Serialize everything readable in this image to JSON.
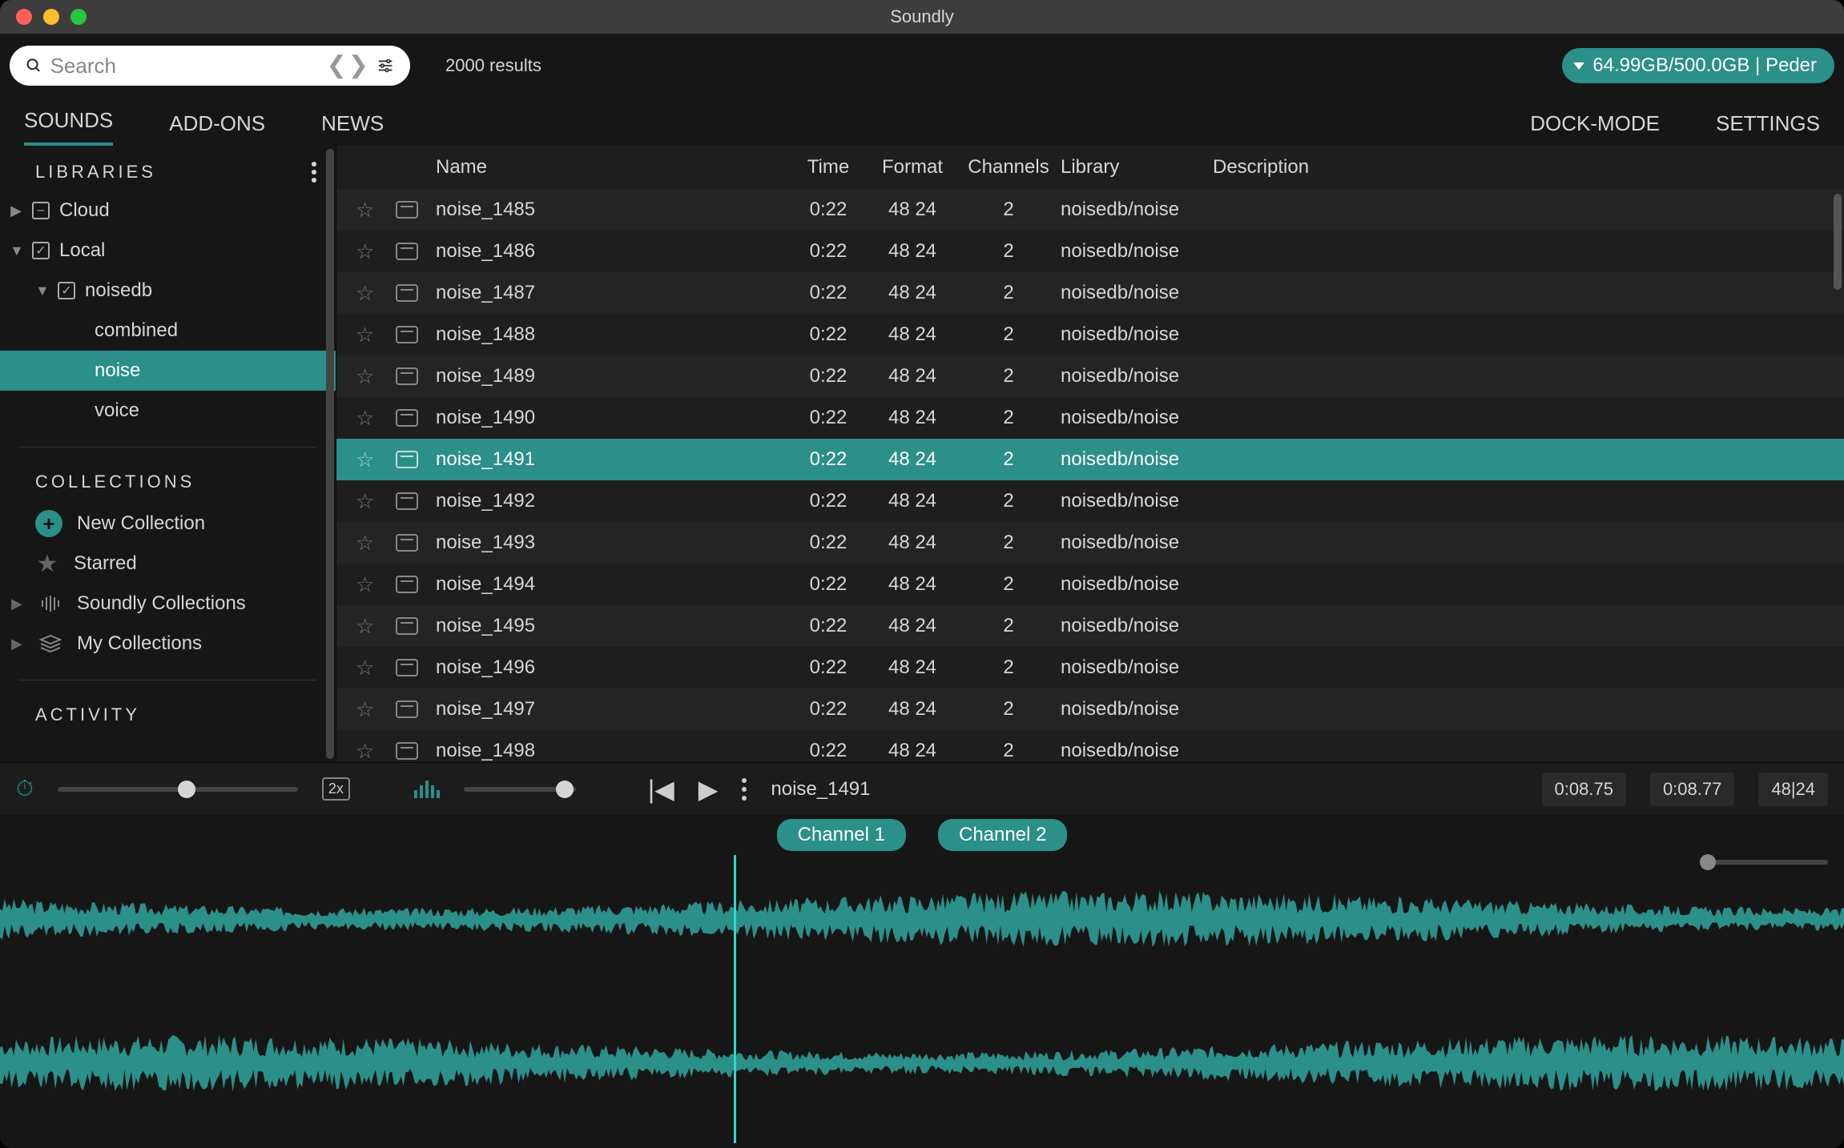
{
  "window": {
    "title": "Soundly"
  },
  "search": {
    "placeholder": "Search",
    "results": "2000 results"
  },
  "storage": {
    "label": "64.99GB/500.0GB | Peder"
  },
  "tabs": {
    "sounds": "SOUNDS",
    "addons": "ADD-ONS",
    "news": "NEWS",
    "dock": "DOCK-MODE",
    "settings": "SETTINGS"
  },
  "sidebar": {
    "libraries_label": "LIBRARIES",
    "cloud": "Cloud",
    "local": "Local",
    "noisedb": "noisedb",
    "combined": "combined",
    "noise": "noise",
    "voice": "voice",
    "collections_label": "COLLECTIONS",
    "new_collection": "New Collection",
    "starred": "Starred",
    "soundly_collections": "Soundly Collections",
    "my_collections": "My Collections",
    "activity_label": "ACTIVITY"
  },
  "table": {
    "headers": {
      "name": "Name",
      "time": "Time",
      "format": "Format",
      "channels": "Channels",
      "library": "Library",
      "description": "Description"
    },
    "rows": [
      {
        "name": "noise_1485",
        "time": "0:22",
        "format": "48 24",
        "channels": "2",
        "library": "noisedb/noise",
        "selected": false
      },
      {
        "name": "noise_1486",
        "time": "0:22",
        "format": "48 24",
        "channels": "2",
        "library": "noisedb/noise",
        "selected": false
      },
      {
        "name": "noise_1487",
        "time": "0:22",
        "format": "48 24",
        "channels": "2",
        "library": "noisedb/noise",
        "selected": false
      },
      {
        "name": "noise_1488",
        "time": "0:22",
        "format": "48 24",
        "channels": "2",
        "library": "noisedb/noise",
        "selected": false
      },
      {
        "name": "noise_1489",
        "time": "0:22",
        "format": "48 24",
        "channels": "2",
        "library": "noisedb/noise",
        "selected": false
      },
      {
        "name": "noise_1490",
        "time": "0:22",
        "format": "48 24",
        "channels": "2",
        "library": "noisedb/noise",
        "selected": false
      },
      {
        "name": "noise_1491",
        "time": "0:22",
        "format": "48 24",
        "channels": "2",
        "library": "noisedb/noise",
        "selected": true
      },
      {
        "name": "noise_1492",
        "time": "0:22",
        "format": "48 24",
        "channels": "2",
        "library": "noisedb/noise",
        "selected": false
      },
      {
        "name": "noise_1493",
        "time": "0:22",
        "format": "48 24",
        "channels": "2",
        "library": "noisedb/noise",
        "selected": false
      },
      {
        "name": "noise_1494",
        "time": "0:22",
        "format": "48 24",
        "channels": "2",
        "library": "noisedb/noise",
        "selected": false
      },
      {
        "name": "noise_1495",
        "time": "0:22",
        "format": "48 24",
        "channels": "2",
        "library": "noisedb/noise",
        "selected": false
      },
      {
        "name": "noise_1496",
        "time": "0:22",
        "format": "48 24",
        "channels": "2",
        "library": "noisedb/noise",
        "selected": false
      },
      {
        "name": "noise_1497",
        "time": "0:22",
        "format": "48 24",
        "channels": "2",
        "library": "noisedb/noise",
        "selected": false
      },
      {
        "name": "noise_1498",
        "time": "0:22",
        "format": "48 24",
        "channels": "2",
        "library": "noisedb/noise",
        "selected": false
      }
    ]
  },
  "player": {
    "speed_label": "2x",
    "now_playing": "noise_1491",
    "time_a": "0:08.75",
    "time_b": "0:08.77",
    "format": "48|24"
  },
  "channels": {
    "ch1": "Channel 1",
    "ch2": "Channel 2"
  }
}
